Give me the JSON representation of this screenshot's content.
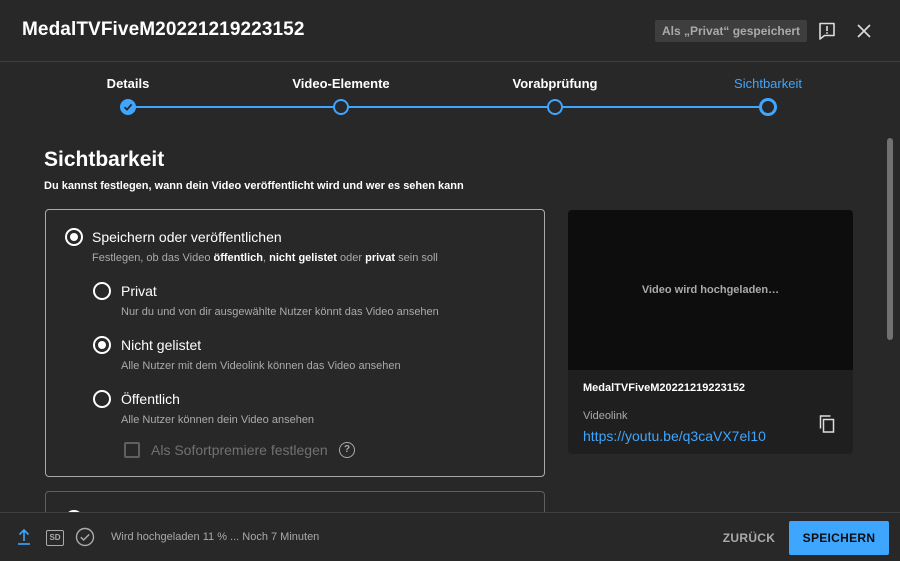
{
  "header": {
    "title": "MedalTVFiveM20221219223152",
    "saved_status": "Als „Privat“ gespeichert",
    "feedback_icon": "feedback-icon",
    "close_icon": "close-icon"
  },
  "stepper": {
    "steps": [
      {
        "label": "Details",
        "state": "done"
      },
      {
        "label": "Video-Elemente",
        "state": "pending"
      },
      {
        "label": "Vorabprüfung",
        "state": "pending"
      },
      {
        "label": "Sichtbarkeit",
        "state": "active"
      }
    ],
    "accent_color": "#3ea6ff"
  },
  "visibility": {
    "title": "Sichtbarkeit",
    "description": "Du kannst festlegen, wann dein Video veröffentlicht wird und wer es sehen kann",
    "save_publish": {
      "label": "Speichern oder veröffentlichen",
      "desc_pre": "Festlegen, ob das Video ",
      "desc_b1": "öffentlich",
      "desc_sep1": ", ",
      "desc_b2": "nicht gelistet",
      "desc_mid": " oder ",
      "desc_b3": "privat",
      "desc_post": " sein soll",
      "selected": true
    },
    "options": [
      {
        "label": "Privat",
        "desc": "Nur du und von dir ausgewählte Nutzer könnt das Video ansehen",
        "selected": false
      },
      {
        "label": "Nicht gelistet",
        "desc": "Alle Nutzer mit dem Videolink können das Video ansehen",
        "selected": true
      },
      {
        "label": "Öffentlich",
        "desc": "Alle Nutzer können dein Video ansehen",
        "selected": false
      }
    ],
    "premiere_label": "Als Sofortpremiere festlegen",
    "premiere_checked": false,
    "help_glyph": "?"
  },
  "preview": {
    "message": "Video wird hochgeladen…",
    "filename": "MedalTVFiveM20221219223152",
    "link_label": "Videolink",
    "link": "https://youtu.be/q3caVX7el10"
  },
  "footer": {
    "sd_label": "SD",
    "status": "Wird hochgeladen 11 % ... Noch 7 Minuten",
    "back_label": "ZURÜCK",
    "save_label": "SPEICHERN"
  }
}
